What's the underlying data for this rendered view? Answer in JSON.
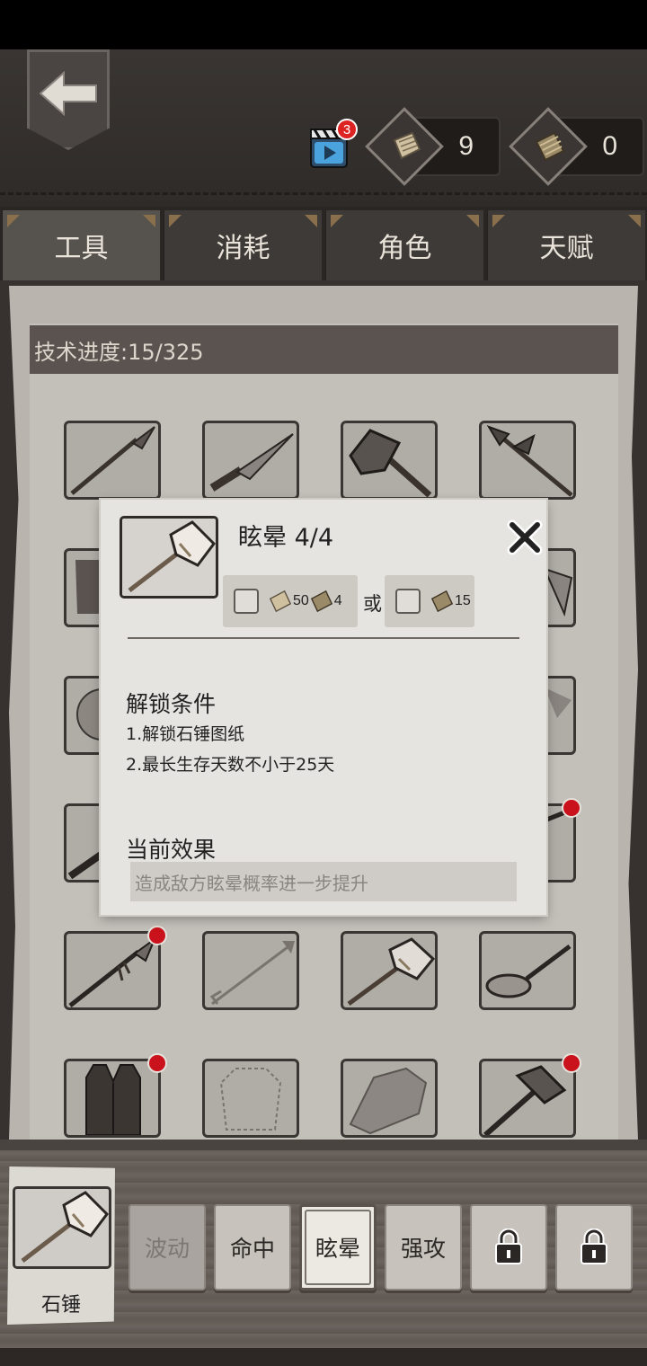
{
  "header": {
    "video_badge": "3",
    "currency": [
      {
        "icon": "blueprint-paper-icon",
        "amount": "9"
      },
      {
        "icon": "blueprint-scroll-icon",
        "amount": "0"
      }
    ]
  },
  "tabs": [
    {
      "label": "工具",
      "active": true
    },
    {
      "label": "消耗",
      "active": false
    },
    {
      "label": "角色",
      "active": false
    },
    {
      "label": "天赋",
      "active": false
    }
  ],
  "progress": {
    "label": "技术进度:15/325"
  },
  "modal": {
    "title": "眩晕 4/4",
    "cost_option_1": {
      "paper": "50",
      "scroll": "4"
    },
    "or_label": "或",
    "cost_option_2": {
      "scroll": "15"
    },
    "unlock_title": "解锁条件",
    "conditions": [
      "1.解锁石锤图纸",
      "2.最长生存天数不小于25天"
    ],
    "effect_title": "当前效果",
    "effect_text": "造成敌方眩晕概率进一步提升"
  },
  "selected_item": {
    "name": "石锤"
  },
  "skills": [
    {
      "label": "波动",
      "state": "disabled"
    },
    {
      "label": "命中",
      "state": "normal"
    },
    {
      "label": "眩晕",
      "state": "active"
    },
    {
      "label": "强攻",
      "state": "normal"
    },
    {
      "label": "",
      "state": "locked"
    },
    {
      "label": "",
      "state": "locked"
    }
  ],
  "colors": {
    "accent_red": "#c9121b",
    "parchment": "#c3c0ba",
    "dark": "#2f2b28"
  }
}
